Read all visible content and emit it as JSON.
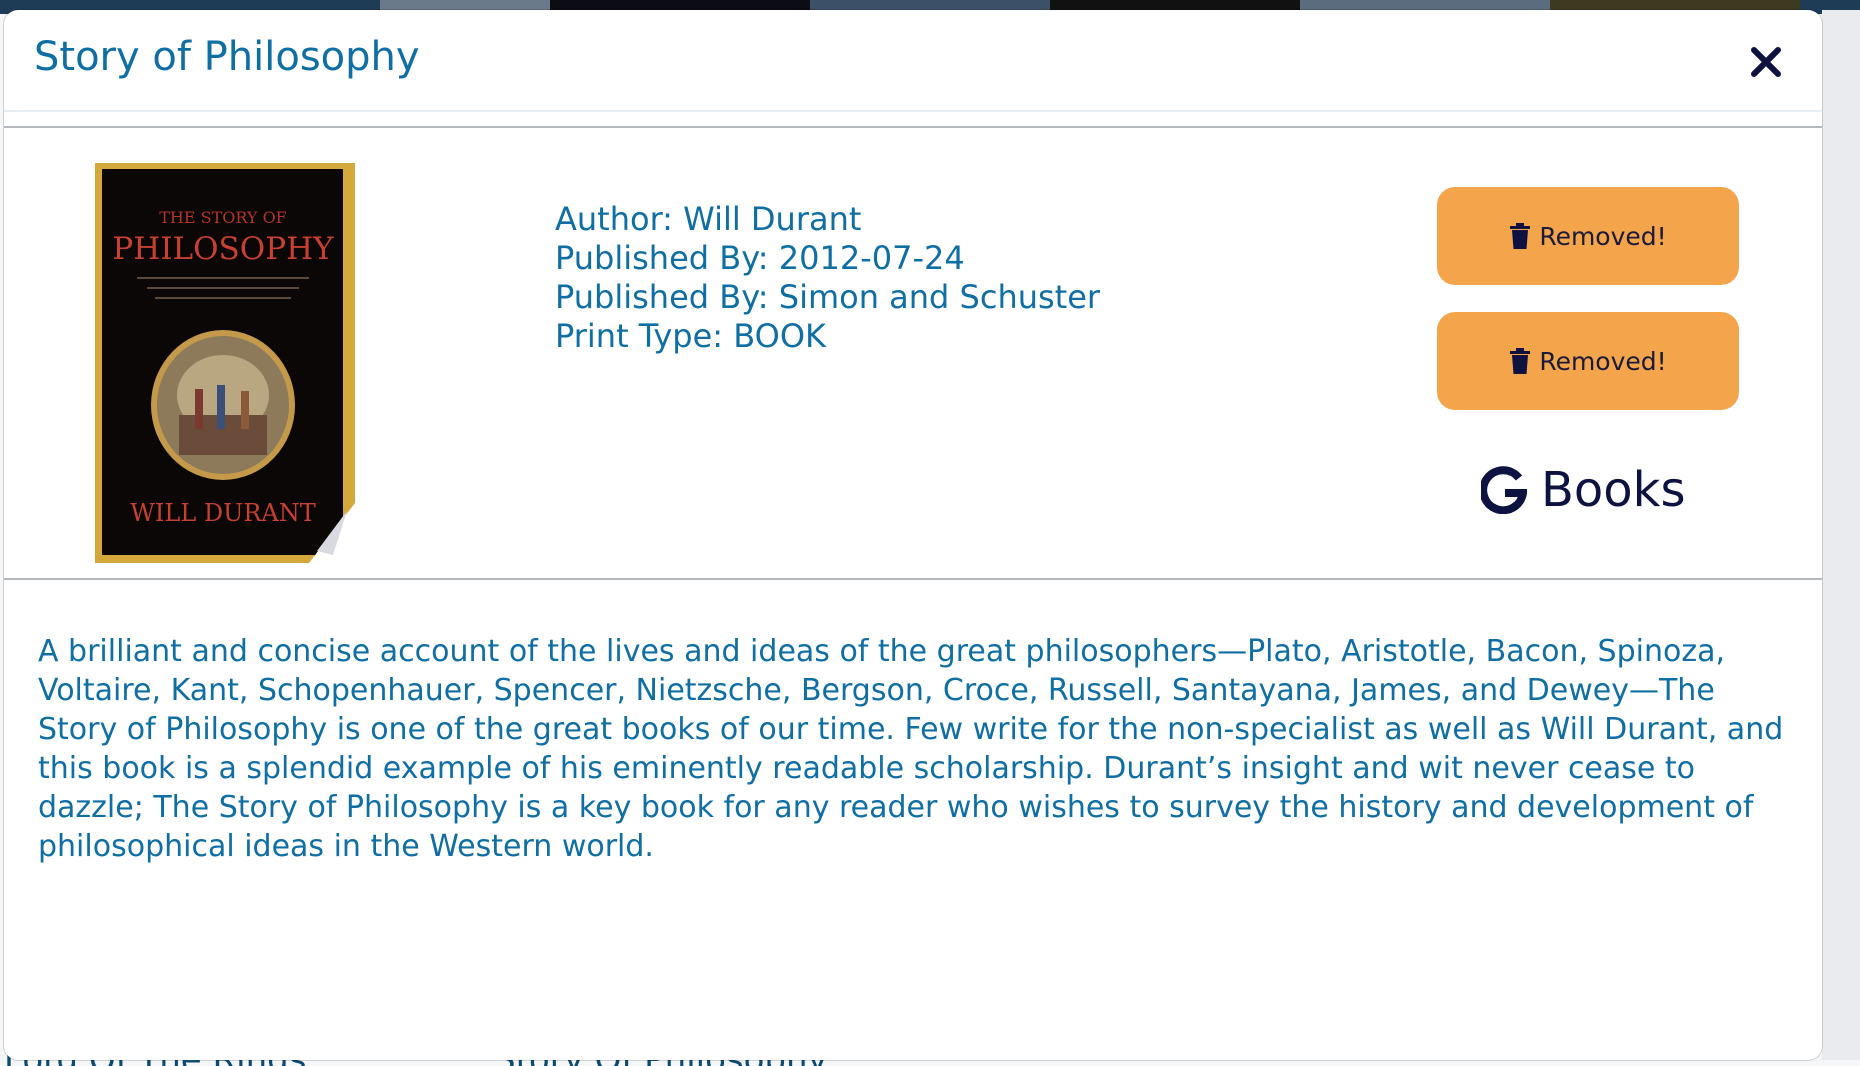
{
  "background": {
    "bottom_texts": [
      "Lord Of The Rings",
      "Story Of Philosophy"
    ]
  },
  "modal": {
    "title": "Story of Philosophy",
    "close_icon": "close-icon",
    "cover": {
      "title_line1": "THE STORY OF",
      "title_line2": "PHILOSOPHY",
      "author": "WILL DURANT"
    },
    "meta": {
      "author": "Author: Will Durant",
      "published_date": "Published By: 2012-07-24",
      "publisher": "Published By: Simon and Schuster",
      "print_type": "Print Type: BOOK"
    },
    "buttons": {
      "removed_1": "Removed!",
      "removed_2": "Removed!",
      "icon": "trash-icon"
    },
    "google_books": {
      "label": "Books",
      "icon": "google-g-icon"
    },
    "description": "A brilliant and concise account of the lives and ideas of the great philosophers—Plato, Aristotle, Bacon, Spinoza, Voltaire, Kant, Schopenhauer, Spencer, Nietzsche, Bergson, Croce, Russell, Santayana, James, and Dewey—The Story of Philosophy is one of the great books of our time. Few write for the non-specialist as well as Will Durant, and this book is a splendid example of his eminently readable scholarship. Durant’s insight and wit never cease to dazzle; The Story of Philosophy is a key book for any reader who wishes to survey the history and development of philosophical ideas in the Western world."
  },
  "colors": {
    "accent_text": "#0f6ea4",
    "button_orange": "#f4a54b",
    "dark_navy": "#0d1240"
  }
}
